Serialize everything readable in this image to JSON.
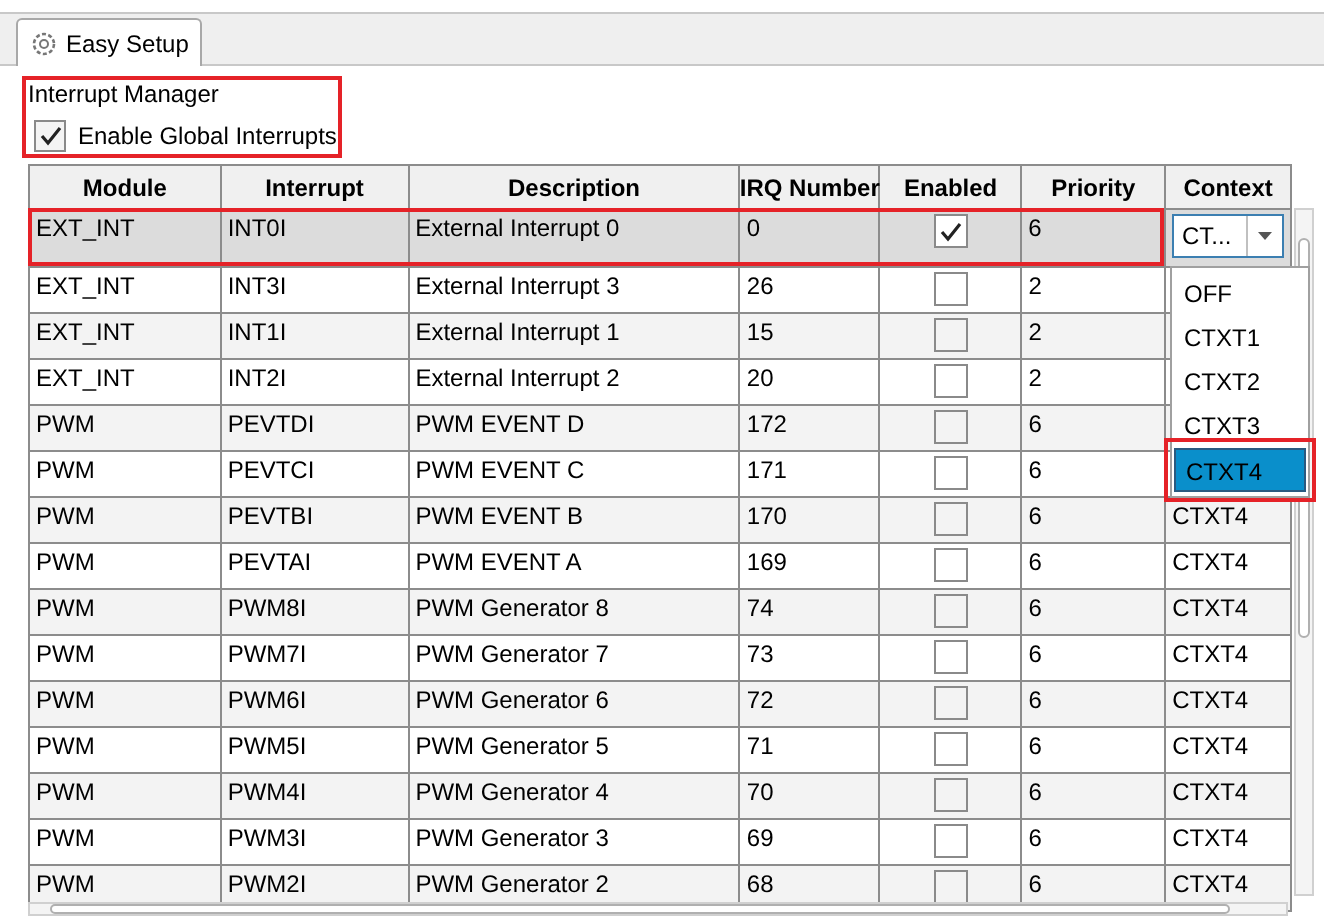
{
  "tabs": [
    {
      "label": "Easy Setup",
      "selected": true
    }
  ],
  "section_title": "Interrupt Manager",
  "global_interrupts": {
    "label": "Enable Global Interrupts",
    "checked": true
  },
  "table": {
    "columns": [
      "Module",
      "Interrupt",
      "Description",
      "IRQ Number",
      "Enabled",
      "Priority",
      "Context"
    ],
    "rows": [
      {
        "module": "EXT_INT",
        "interrupt": "INT0I",
        "description": "External Interrupt 0",
        "irq": "0",
        "enabled": true,
        "priority": "6",
        "selected": true
      },
      {
        "module": "EXT_INT",
        "interrupt": "INT3I",
        "description": "External Interrupt 3",
        "irq": "26",
        "enabled": false,
        "priority": "2",
        "selected": false
      },
      {
        "module": "EXT_INT",
        "interrupt": "INT1I",
        "description": "External Interrupt 1",
        "irq": "15",
        "enabled": false,
        "priority": "2",
        "selected": false
      },
      {
        "module": "EXT_INT",
        "interrupt": "INT2I",
        "description": "External Interrupt 2",
        "irq": "20",
        "enabled": false,
        "priority": "2",
        "selected": false
      },
      {
        "module": "PWM",
        "interrupt": "PEVTDI",
        "description": "PWM EVENT D",
        "irq": "172",
        "enabled": false,
        "priority": "6",
        "selected": false
      },
      {
        "module": "PWM",
        "interrupt": "PEVTCI",
        "description": "PWM EVENT C",
        "irq": "171",
        "enabled": false,
        "priority": "6",
        "selected": false
      },
      {
        "module": "PWM",
        "interrupt": "PEVTBI",
        "description": "PWM EVENT B",
        "irq": "170",
        "enabled": false,
        "priority": "6",
        "context": "CTXT4",
        "selected": false
      },
      {
        "module": "PWM",
        "interrupt": "PEVTAI",
        "description": "PWM EVENT A",
        "irq": "169",
        "enabled": false,
        "priority": "6",
        "context": "CTXT4",
        "selected": false
      },
      {
        "module": "PWM",
        "interrupt": "PWM8I",
        "description": "PWM Generator 8",
        "irq": "74",
        "enabled": false,
        "priority": "6",
        "context": "CTXT4",
        "selected": false
      },
      {
        "module": "PWM",
        "interrupt": "PWM7I",
        "description": "PWM Generator 7",
        "irq": "73",
        "enabled": false,
        "priority": "6",
        "context": "CTXT4",
        "selected": false
      },
      {
        "module": "PWM",
        "interrupt": "PWM6I",
        "description": "PWM Generator 6",
        "irq": "72",
        "enabled": false,
        "priority": "6",
        "context": "CTXT4",
        "selected": false
      },
      {
        "module": "PWM",
        "interrupt": "PWM5I",
        "description": "PWM Generator 5",
        "irq": "71",
        "enabled": false,
        "priority": "6",
        "context": "CTXT4",
        "selected": false
      },
      {
        "module": "PWM",
        "interrupt": "PWM4I",
        "description": "PWM Generator 4",
        "irq": "70",
        "enabled": false,
        "priority": "6",
        "context": "CTXT4",
        "selected": false
      },
      {
        "module": "PWM",
        "interrupt": "PWM3I",
        "description": "PWM Generator 3",
        "irq": "69",
        "enabled": false,
        "priority": "6",
        "context": "CTXT4",
        "selected": false
      },
      {
        "module": "PWM",
        "interrupt": "PWM2I",
        "description": "PWM Generator 2",
        "irq": "68",
        "enabled": false,
        "priority": "6",
        "context": "CTXT4",
        "selected": false
      }
    ]
  },
  "context_dropdown": {
    "value": "CT...",
    "expanded": true,
    "options": [
      {
        "label": "OFF",
        "selected": false
      },
      {
        "label": "CTXT1",
        "selected": false
      },
      {
        "label": "CTXT2",
        "selected": false
      },
      {
        "label": "CTXT3",
        "selected": false
      },
      {
        "label": "CTXT4",
        "selected": true
      }
    ]
  }
}
